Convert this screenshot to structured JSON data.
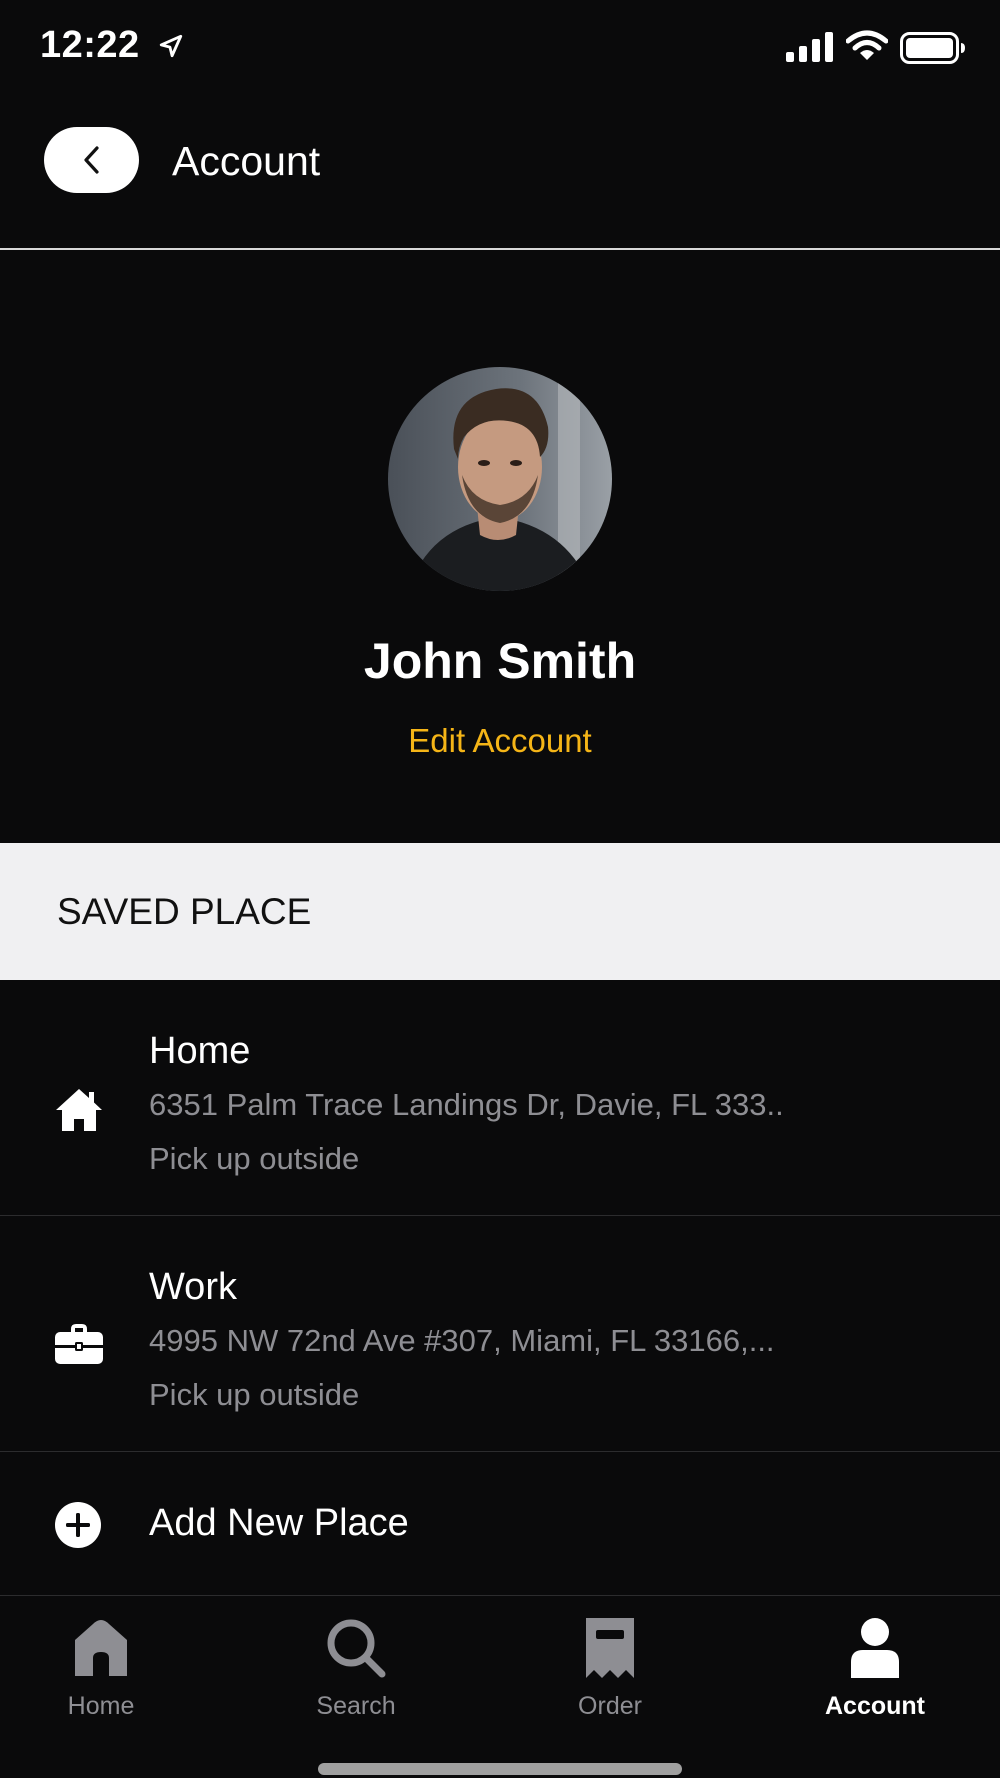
{
  "status_bar": {
    "time": "12:22"
  },
  "header": {
    "title": "Account"
  },
  "profile": {
    "name": "John Smith",
    "edit_label": "Edit Account"
  },
  "section": {
    "label": "SAVED PLACE"
  },
  "places": [
    {
      "icon": "house-icon",
      "title": "Home",
      "address": "6351 Palm Trace Landings Dr, Davie, FL 333..",
      "note": "Pick up outside"
    },
    {
      "icon": "briefcase-icon",
      "title": "Work",
      "address": "4995 NW 72nd Ave #307, Miami, FL 33166,...",
      "note": "Pick up outside"
    }
  ],
  "add_place": {
    "icon": "plus-circle-icon",
    "label": "Add New Place"
  },
  "tab_bar": {
    "tabs": [
      {
        "label": "Home",
        "icon": "home-icon",
        "active": false
      },
      {
        "label": "Search",
        "icon": "search-icon",
        "active": false
      },
      {
        "label": "Order",
        "icon": "receipt-icon",
        "active": false
      },
      {
        "label": "Account",
        "icon": "person-icon",
        "active": true
      }
    ]
  },
  "colors": {
    "background": "#0a0a0b",
    "accent": "#f5b517",
    "secondary_text": "#8e8e93",
    "section_bg": "#f0f0f2"
  }
}
